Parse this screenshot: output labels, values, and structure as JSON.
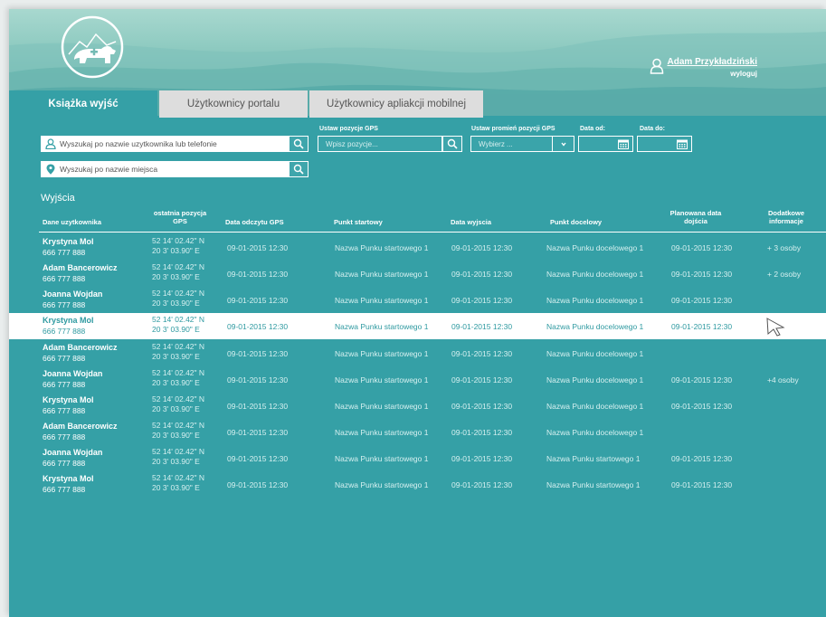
{
  "header": {
    "user_name": "Adam Przykładziński",
    "logout": "wyloguj"
  },
  "tabs": [
    {
      "label": "Książka wyjść",
      "active": true
    },
    {
      "label": "Użytkownicy portalu",
      "active": false
    },
    {
      "label": "Użytkownicy apliakcji mobilnej",
      "active": false
    }
  ],
  "filters": {
    "user_search_placeholder": "Wyszukaj po nazwie uzytkownika lub telefonie",
    "place_search_placeholder": "Wyszukaj po nazwie miejsca",
    "gps_label": "Ustaw pozycje GPS",
    "gps_placeholder": "Wpisz pozycje...",
    "radius_label": "Ustaw promień pozycji GPS",
    "radius_placeholder": "Wybierz ...",
    "date_from_label": "Data od:",
    "date_to_label": "Data do:"
  },
  "table": {
    "title": "Wyjścia",
    "columns": {
      "user": "Dane uzytkownika",
      "gps_last": "ostatnia pozycja GPS",
      "gps_read": "Data odczytu GPS",
      "start": "Punkt startowy",
      "exit_date": "Data wyjscia",
      "dest": "Punkt docelowy",
      "planned": "Planowana data dojścia",
      "extra": "Dodatkowe informacje"
    },
    "rows": [
      {
        "name": "Krystyna Mol",
        "phone": "666 777 888",
        "gps1": "52 14' 02.42\" N",
        "gps2": "20 3' 03.90\" E",
        "gps_date": "09-01-2015 12:30",
        "start": "Nazwa Punku startowego 1",
        "exit_date": "09-01-2015 12:30",
        "dest": "Nazwa Punku docelowego 1",
        "planned": "09-01-2015 12:30",
        "extra": "+ 3 osoby"
      },
      {
        "name": "Adam Bancerowicz",
        "phone": "666 777 888",
        "gps1": "52 14' 02.42\" N",
        "gps2": "20 3' 03.90\" E",
        "gps_date": "09-01-2015 12:30",
        "start": "Nazwa Punku startowego 1",
        "exit_date": "09-01-2015 12:30",
        "dest": "Nazwa Punku docelowego 1",
        "planned": "09-01-2015 12:30",
        "extra": "+ 2 osoby"
      },
      {
        "name": "Joanna Wojdan",
        "phone": "666 777 888",
        "gps1": "52 14' 02.42\" N",
        "gps2": "20 3' 03.90\" E",
        "gps_date": "09-01-2015 12:30",
        "start": "Nazwa Punku startowego 1",
        "exit_date": "09-01-2015 12:30",
        "dest": "Nazwa Punku docelowego 1",
        "planned": "09-01-2015 12:30",
        "extra": ""
      },
      {
        "name": "Krystyna Mol",
        "phone": "666 777 888",
        "gps1": "52 14' 02.42\" N",
        "gps2": "20 3' 03.90\" E",
        "gps_date": "09-01-2015 12:30",
        "start": "Nazwa Punku startowego 1",
        "exit_date": "09-01-2015 12:30",
        "dest": "Nazwa Punku docelowego 1",
        "planned": "09-01-2015 12:30",
        "extra": "",
        "highlighted": true
      },
      {
        "name": "Adam Bancerowicz",
        "phone": "666 777 888",
        "gps1": "52 14' 02.42\" N",
        "gps2": "20 3' 03.90\" E",
        "gps_date": "09-01-2015 12:30",
        "start": "Nazwa Punku startowego 1",
        "exit_date": "09-01-2015 12:30",
        "dest": "Nazwa Punku docelowego 1",
        "planned": "",
        "extra": ""
      },
      {
        "name": "Joanna Wojdan",
        "phone": "666 777 888",
        "gps1": "52 14' 02.42\" N",
        "gps2": "20 3' 03.90\" E",
        "gps_date": "09-01-2015 12:30",
        "start": "Nazwa Punku startowego 1",
        "exit_date": "09-01-2015 12:30",
        "dest": "Nazwa Punku docelowego 1",
        "planned": "09-01-2015 12:30",
        "extra": "+4 osoby"
      },
      {
        "name": "Krystyna Mol",
        "phone": "666 777 888",
        "gps1": "52 14' 02.42\" N",
        "gps2": "20 3' 03.90\" E",
        "gps_date": "09-01-2015 12:30",
        "start": "Nazwa Punku startowego 1",
        "exit_date": "09-01-2015 12:30",
        "dest": "Nazwa Punku docelowego 1",
        "planned": "09-01-2015 12:30",
        "extra": ""
      },
      {
        "name": "Adam Bancerowicz",
        "phone": "666 777 888",
        "gps1": "52 14' 02.42\" N",
        "gps2": "20 3' 03.90\" E",
        "gps_date": "09-01-2015 12:30",
        "start": "Nazwa Punku startowego 1",
        "exit_date": "09-01-2015 12:30",
        "dest": "Nazwa Punku docelowego 1",
        "planned": "",
        "extra": ""
      },
      {
        "name": "Joanna Wojdan",
        "phone": "666 777 888",
        "gps1": "52 14' 02.42\" N",
        "gps2": "20 3' 03.90\" E",
        "gps_date": "09-01-2015 12:30",
        "start": "Nazwa Punku startowego 1",
        "exit_date": "09-01-2015 12:30",
        "dest": "Nazwa Punku startowego 1",
        "planned": "09-01-2015 12:30",
        "extra": ""
      },
      {
        "name": "Krystyna Mol",
        "phone": "666 777 888",
        "gps1": "52 14' 02.42\" N",
        "gps2": "20 3' 03.90\" E",
        "gps_date": "09-01-2015 12:30",
        "start": "Nazwa Punku startowego 1",
        "exit_date": "09-01-2015 12:30",
        "dest": "Nazwa Punku startowego 1",
        "planned": "09-01-2015 12:30",
        "extra": ""
      }
    ]
  }
}
